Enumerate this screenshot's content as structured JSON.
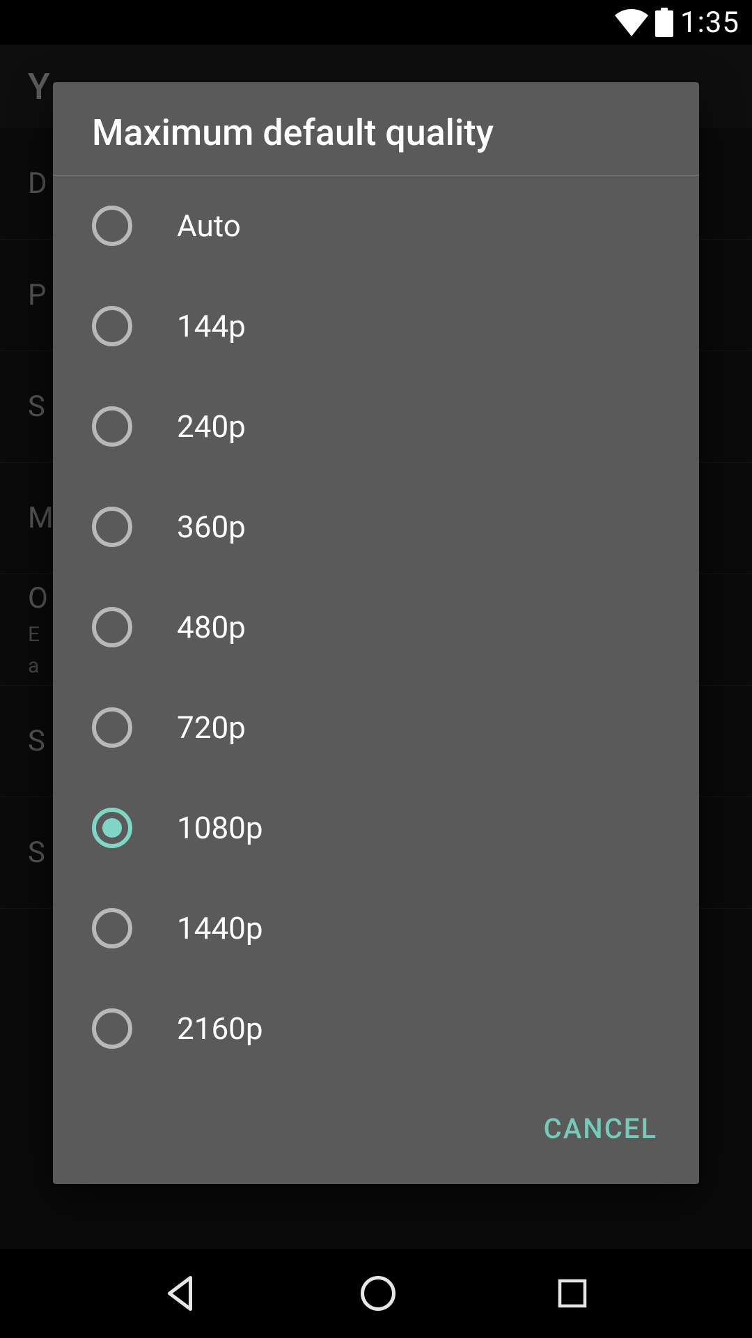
{
  "status": {
    "time": "1:35"
  },
  "background": {
    "app_title": "Y",
    "rows": {
      "r0": "D",
      "r1": "P",
      "r2": "S",
      "r3": "M",
      "r4_title": "O",
      "r4_sub1": "E",
      "r4_sub2": "a",
      "r5": "S",
      "r6": "S"
    }
  },
  "dialog": {
    "title": "Maximum default quality",
    "selected_index": 6,
    "options": [
      {
        "label": "Auto"
      },
      {
        "label": "144p"
      },
      {
        "label": "240p"
      },
      {
        "label": "360p"
      },
      {
        "label": "480p"
      },
      {
        "label": "720p"
      },
      {
        "label": "1080p"
      },
      {
        "label": "1440p"
      },
      {
        "label": "2160p"
      }
    ],
    "cancel": "CANCEL"
  },
  "accent_color": "#77cab9"
}
